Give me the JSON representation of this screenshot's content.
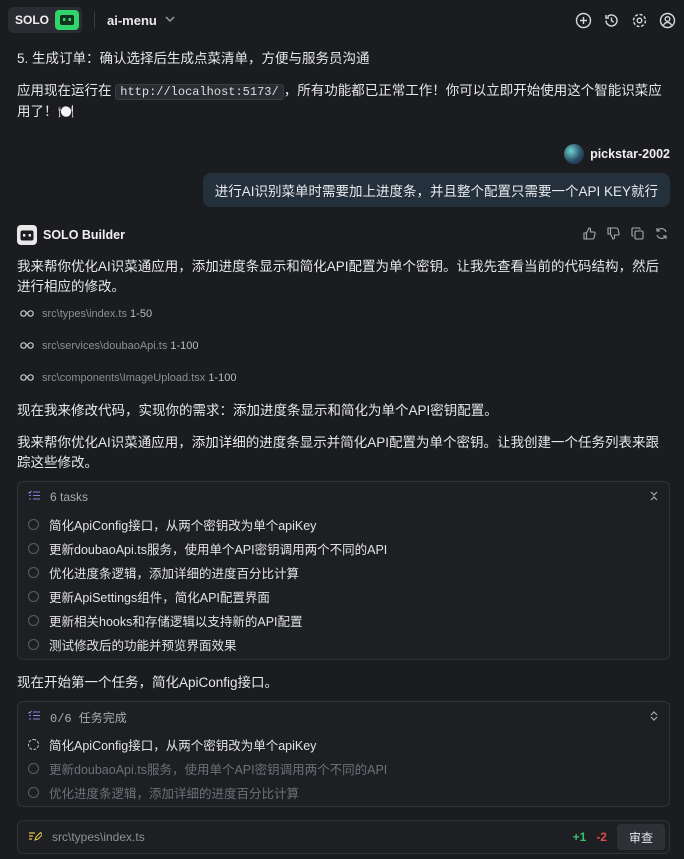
{
  "header": {
    "brand": "SOLO",
    "project": "ai-menu"
  },
  "prev": {
    "step5": "5. 生成订单：确认选择后生成点菜清单，方便与服务员沟通",
    "run_prefix": "应用现在运行在",
    "url": "http://localhost:5173/",
    "run_suffix": "，所有功能都已正常工作！你可以立即开始使用这个智能识菜应用了！🍽️"
  },
  "user": {
    "name": "pickstar-2002",
    "message": "进行AI识别菜单时需要加上进度条，并且整个配置只需要一个API KEY就行"
  },
  "assistant": {
    "name": "SOLO Builder",
    "intro": "我来帮你优化AI识菜通应用，添加进度条显示和简化API配置为单个密钥。让我先查看当前的代码结构，然后进行相应的修改。",
    "files": [
      {
        "path": "src\\types\\index.ts",
        "range": "1-50"
      },
      {
        "path": "src\\services\\doubaoApi.ts",
        "range": "1-100"
      },
      {
        "path": "src\\components\\ImageUpload.tsx",
        "range": "1-100"
      }
    ],
    "now_modify": "现在我来修改代码，实现你的需求：添加进度条显示和简化为单个API密钥配置。",
    "plan": "我来帮你优化AI识菜通应用，添加详细的进度条显示并简化API配置为单个密钥。让我创建一个任务列表来跟踪这些修改。",
    "start_first": "现在开始第一个任务，简化ApiConfig接口。"
  },
  "tasks_card": {
    "title": "6 tasks",
    "items": [
      "简化ApiConfig接口，从两个密钥改为单个apiKey",
      "更新doubaoApi.ts服务，使用单个API密钥调用两个不同的API",
      "优化进度条逻辑，添加详细的进度百分比计算",
      "更新ApiSettings组件，简化API配置界面",
      "更新相关hooks和存储逻辑以支持新的API配置",
      "测试修改后的功能并预览界面效果"
    ]
  },
  "progress_card": {
    "title": "0/6 任务完成",
    "done": 0,
    "total": 6,
    "items": [
      "简化ApiConfig接口，从两个密钥改为单个apiKey",
      "更新doubaoApi.ts服务，使用单个API密钥调用两个不同的API",
      "优化进度条逻辑，添加详细的进度百分比计算"
    ]
  },
  "diff": {
    "path": "src\\types\\index.ts",
    "added": "+1",
    "removed": "-2",
    "review_label": "审查"
  },
  "colors": {
    "accent": "#2fd46a",
    "added": "#35c16b",
    "removed": "#e0494f"
  }
}
